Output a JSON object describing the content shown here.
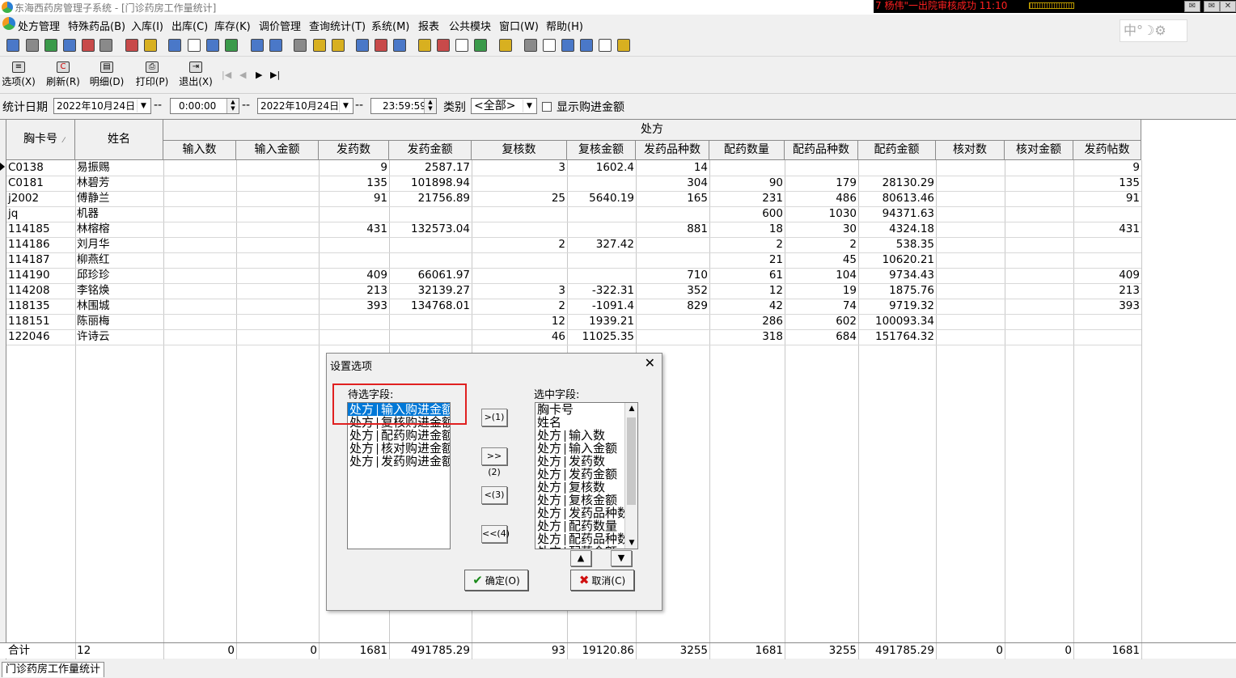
{
  "window": {
    "title": "东海西药房管理子系统 - [门诊药房工作量统计]"
  },
  "ticker": "7 杨伟\"一出院审核成功 11:10",
  "menu": [
    "处方管理",
    "特殊药品(B)",
    "入库(I)",
    "出库(C)",
    "库存(K)",
    "调价管理",
    "查询统计(T)",
    "系统(M)",
    "报表",
    "公共模块",
    "窗口(W)",
    "帮助(H)"
  ],
  "ime": "中°☽⚙",
  "toolbar": [
    {
      "glyph": "≡",
      "label": "选项(X)"
    },
    {
      "glyph": "C",
      "label": "刷新(R)"
    },
    {
      "glyph": "▤",
      "label": "明细(D)"
    },
    {
      "glyph": "⎙",
      "label": "打印(P)"
    },
    {
      "glyph": "⇥",
      "label": "退出(X)"
    }
  ],
  "nav": {
    "first": "|◀",
    "prev": "◀",
    "next": "▶",
    "last": "▶|"
  },
  "filter": {
    "date_label": "统计日期",
    "date_from": "2022年10月24日",
    "time_from": "0:00:00",
    "sep": "--",
    "date_to": "2022年10月24日",
    "time_to": "23:59:59",
    "category_label": "类别",
    "category_value": "<全部>",
    "checkbox_label": "显示购进金额"
  },
  "table": {
    "group_header": "处方",
    "fixed_headers": [
      "胸卡号",
      "姓名"
    ],
    "headers": [
      "输入数",
      "输入金额",
      "发药数",
      "发药金额",
      "复核数",
      "复核金额",
      "发药品种数",
      "配药数量",
      "配药品种数",
      "配药金额",
      "核对数",
      "核对金额",
      "发药帖数"
    ],
    "rows": [
      [
        "C0138",
        "易振赐",
        "",
        "",
        "9",
        "2587.17",
        "3",
        "1602.4",
        "14",
        "",
        "",
        "",
        "",
        "",
        "9"
      ],
      [
        "C0181",
        "林碧芳",
        "",
        "",
        "135",
        "101898.94",
        "",
        "",
        "304",
        "90",
        "179",
        "28130.29",
        "",
        "",
        "135"
      ],
      [
        "j2002",
        "傅静兰",
        "",
        "",
        "91",
        "21756.89",
        "25",
        "5640.19",
        "165",
        "231",
        "486",
        "80613.46",
        "",
        "",
        "91"
      ],
      [
        "jq",
        "机器",
        "",
        "",
        "",
        "",
        "",
        "",
        "",
        "600",
        "1030",
        "94371.63",
        "",
        "",
        ""
      ],
      [
        "114185",
        "林榕榕",
        "",
        "",
        "431",
        "132573.04",
        "",
        "",
        "881",
        "18",
        "30",
        "4324.18",
        "",
        "",
        "431"
      ],
      [
        "114186",
        "刘月华",
        "",
        "",
        "",
        "",
        "2",
        "327.42",
        "",
        "2",
        "2",
        "538.35",
        "",
        "",
        ""
      ],
      [
        "114187",
        "柳燕红",
        "",
        "",
        "",
        "",
        "",
        "",
        "",
        "21",
        "45",
        "10620.21",
        "",
        "",
        ""
      ],
      [
        "114190",
        "邱珍珍",
        "",
        "",
        "409",
        "66061.97",
        "",
        "",
        "710",
        "61",
        "104",
        "9734.43",
        "",
        "",
        "409"
      ],
      [
        "114208",
        "李铭焕",
        "",
        "",
        "213",
        "32139.27",
        "3",
        "-322.31",
        "352",
        "12",
        "19",
        "1875.76",
        "",
        "",
        "213"
      ],
      [
        "118135",
        "林围城",
        "",
        "",
        "393",
        "134768.01",
        "2",
        "-1091.4",
        "829",
        "42",
        "74",
        "9719.32",
        "",
        "",
        "393"
      ],
      [
        "118151",
        "陈丽梅",
        "",
        "",
        "",
        "",
        "12",
        "1939.21",
        "",
        "286",
        "602",
        "100093.34",
        "",
        "",
        ""
      ],
      [
        "122046",
        "许诗云",
        "",
        "",
        "",
        "",
        "46",
        "11025.35",
        "",
        "318",
        "684",
        "151764.32",
        "",
        "",
        ""
      ]
    ],
    "totals": [
      "合计",
      "12",
      "0",
      "0",
      "1681",
      "491785.29",
      "93",
      "19120.86",
      "3255",
      "1681",
      "3255",
      "491785.29",
      "0",
      "0",
      "1681"
    ]
  },
  "status_tab": "门诊药房工作量统计",
  "dialog": {
    "title": "设置选项",
    "close": "✕",
    "available_label": "待选字段:",
    "selected_label": "选中字段:",
    "available": [
      {
        "a": "处方",
        "b": "输入购进金额"
      },
      {
        "a": "处方",
        "b": "复核购进金额"
      },
      {
        "a": "处方",
        "b": "配药购进金额"
      },
      {
        "a": "处方",
        "b": "核对购进金额"
      },
      {
        "a": "处方",
        "b": "发药购进金额"
      }
    ],
    "selected": [
      {
        "a": "胸卡号",
        "b": ""
      },
      {
        "a": "姓名",
        "b": ""
      },
      {
        "a": "处方",
        "b": "输入数"
      },
      {
        "a": "处方",
        "b": "输入金额"
      },
      {
        "a": "处方",
        "b": "发药数"
      },
      {
        "a": "处方",
        "b": "发药金额"
      },
      {
        "a": "处方",
        "b": "复核数"
      },
      {
        "a": "处方",
        "b": "复核金额"
      },
      {
        "a": "处方",
        "b": "发药品种数"
      },
      {
        "a": "处方",
        "b": "配药数量"
      },
      {
        "a": "处方",
        "b": "配药品种数"
      },
      {
        "a": "处方",
        "b": "配药金额"
      }
    ],
    "move_buttons": [
      ">(1)",
      ">>(2)",
      "<(3)",
      "<<(4)"
    ],
    "up": "▲",
    "down": "▼",
    "ok": "确定(O)",
    "cancel": "取消(C)"
  }
}
